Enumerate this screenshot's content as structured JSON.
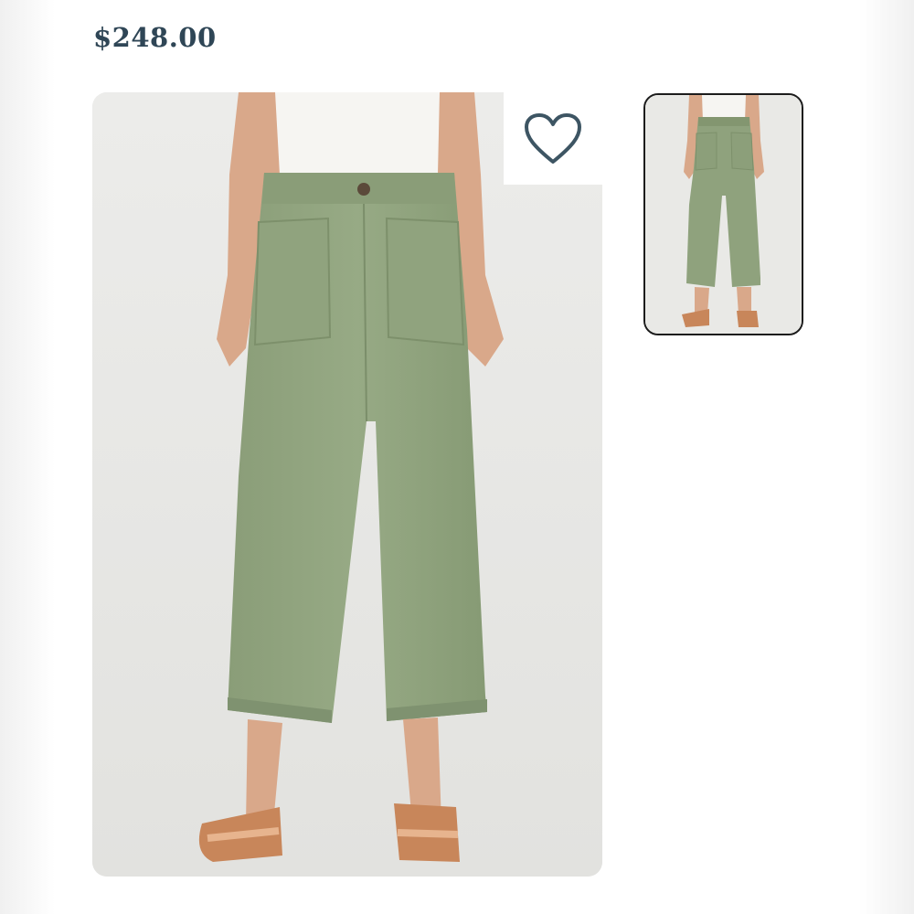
{
  "product": {
    "price": "$248.00",
    "main_image": {
      "alt": ""
    },
    "favorite_icon": "heart-outline-icon",
    "thumbnails": [
      {
        "alt": ""
      }
    ]
  },
  "colors": {
    "price_text": "#2f4656",
    "heart_stroke": "#3d5563",
    "pants_green": "#8fa27d",
    "thumb_border": "#1c1c1c"
  }
}
